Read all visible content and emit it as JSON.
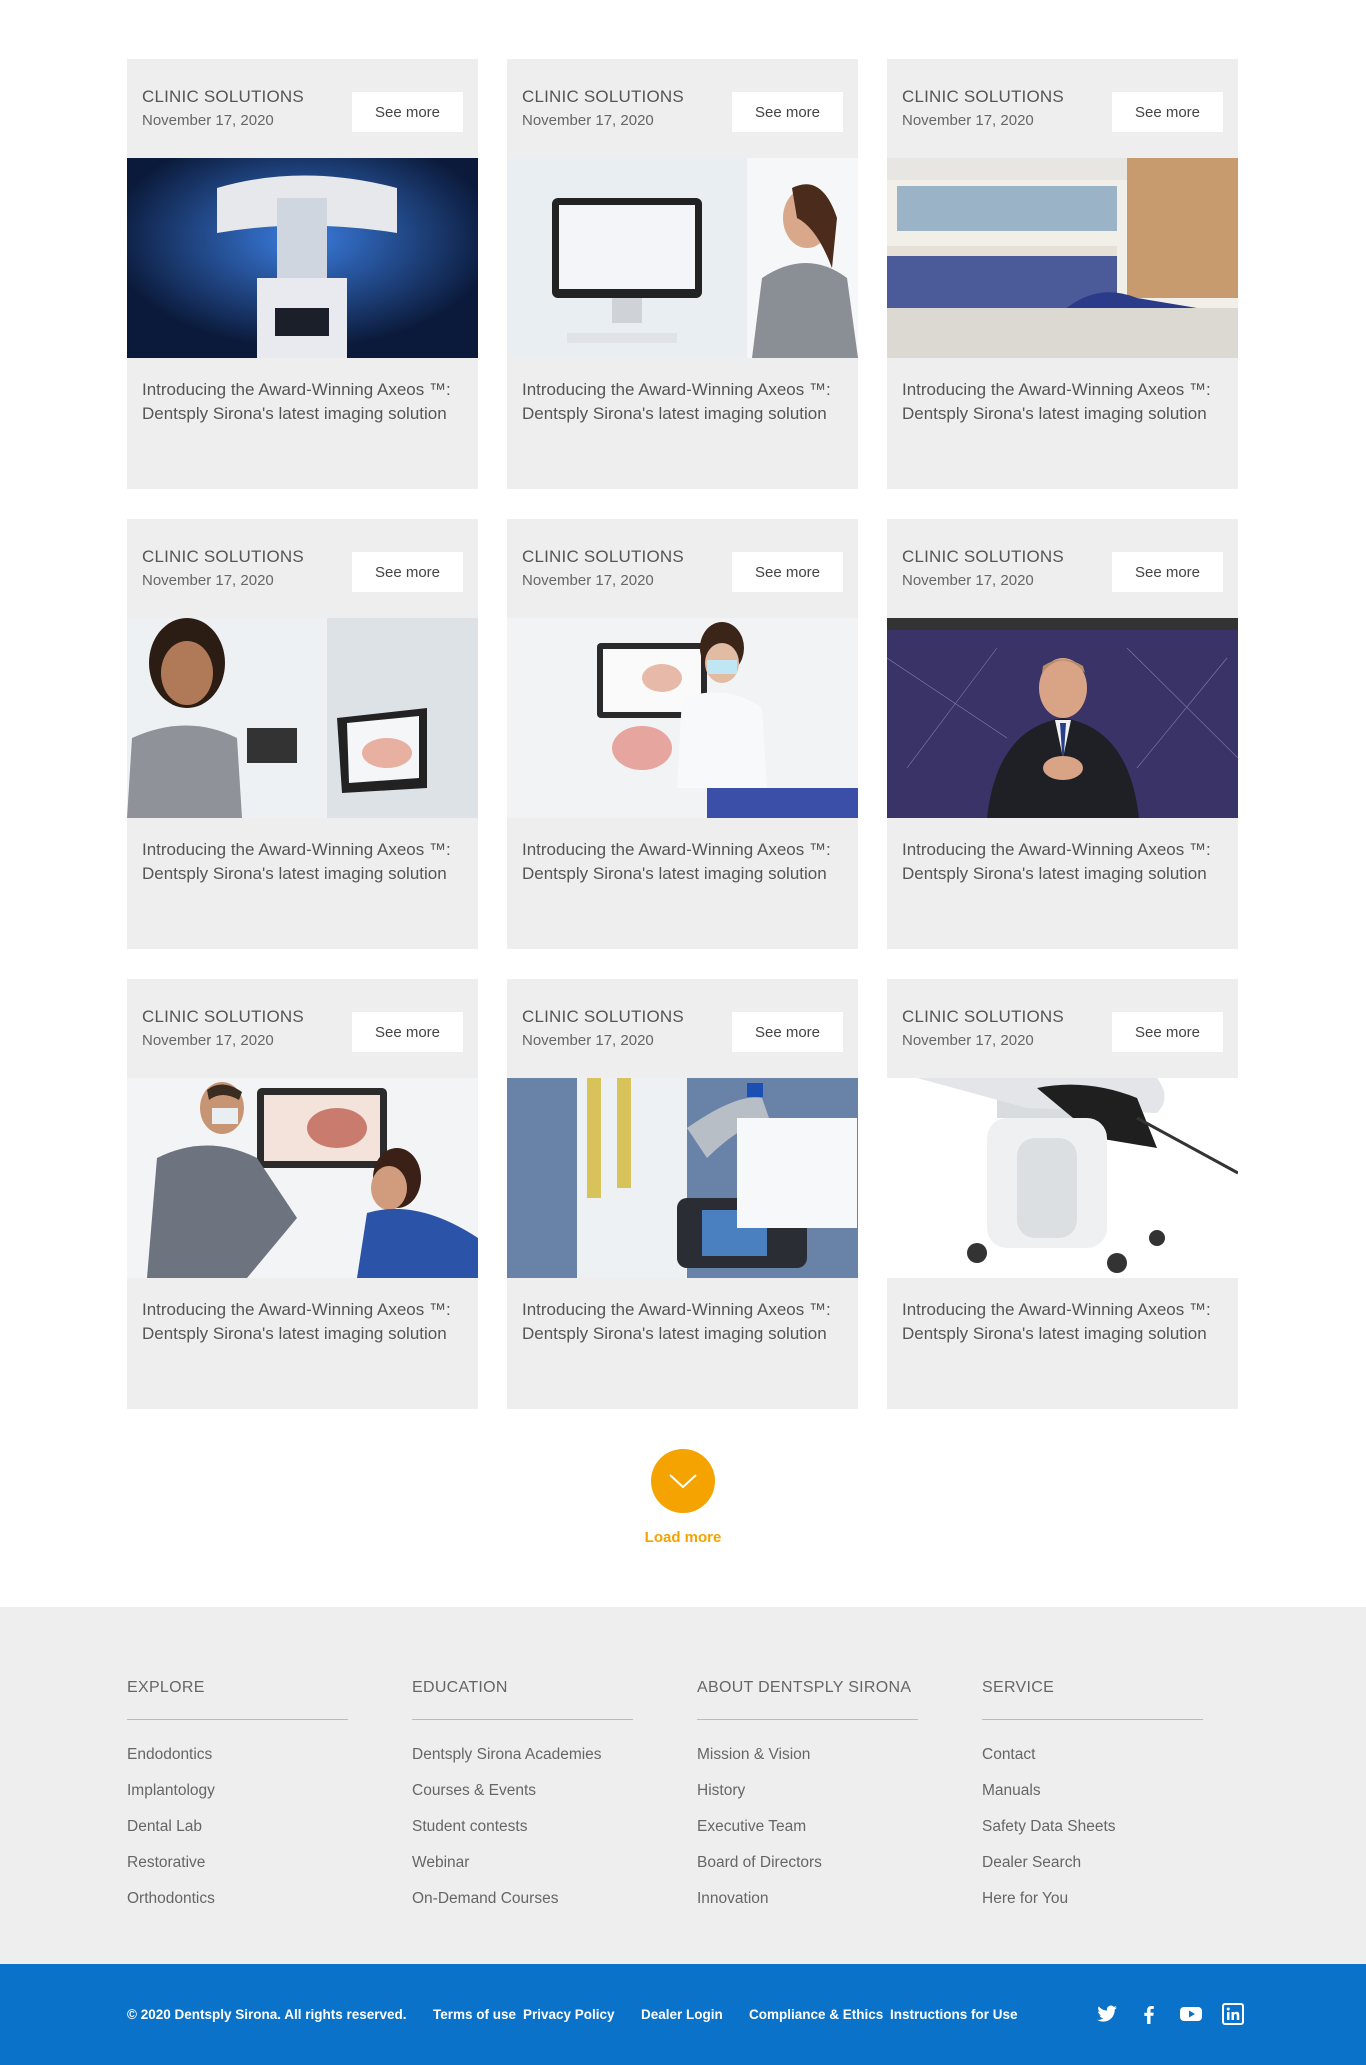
{
  "cards": [
    {
      "category": "CLINIC SOLUTIONS",
      "date": "November 17, 2020",
      "button": "See more",
      "title": "Introducing the Award-Winning Axeos ™: Dentsply Sirona's latest imaging solution",
      "image": "imaging-unit"
    },
    {
      "category": "CLINIC SOLUTIONS",
      "date": "November 17, 2020",
      "button": "See more",
      "title": "Introducing the Award-Winning Axeos ™: Dentsply Sirona's latest imaging solution",
      "image": "woman-at-computer"
    },
    {
      "category": "CLINIC SOLUTIONS",
      "date": "November 17, 2020",
      "button": "See more",
      "title": "Introducing the Award-Winning Axeos ™: Dentsply Sirona's latest imaging solution",
      "image": "dental-office"
    },
    {
      "category": "CLINIC SOLUTIONS",
      "date": "November 17, 2020",
      "button": "See more",
      "title": "Introducing the Award-Winning Axeos ™: Dentsply Sirona's latest imaging solution",
      "image": "woman-with-scanner-screen"
    },
    {
      "category": "CLINIC SOLUTIONS",
      "date": "November 17, 2020",
      "button": "See more",
      "title": "Introducing the Award-Winning Axeos ™: Dentsply Sirona's latest imaging solution",
      "image": "dental-technician"
    },
    {
      "category": "CLINIC SOLUTIONS",
      "date": "November 17, 2020",
      "button": "See more",
      "title": "Introducing the Award-Winning Axeos ™: Dentsply Sirona's latest imaging solution",
      "image": "presenter-in-suit"
    },
    {
      "category": "CLINIC SOLUTIONS",
      "date": "November 17, 2020",
      "button": "See more",
      "title": "Introducing the Award-Winning Axeos ™: Dentsply Sirona's latest imaging solution",
      "image": "dentist-with-patient"
    },
    {
      "category": "CLINIC SOLUTIONS",
      "date": "November 17, 2020",
      "button": "See more",
      "title": "Introducing the Award-Winning Axeos ™: Dentsply Sirona's latest imaging solution",
      "image": "treatment-unit-touchscreen"
    },
    {
      "category": "CLINIC SOLUTIONS",
      "date": "November 17, 2020",
      "button": "See more",
      "title": "Introducing the Award-Winning Axeos ™: Dentsply Sirona's latest imaging solution",
      "image": "intraoral-scanner-cart"
    }
  ],
  "load_more": {
    "label": "Load more",
    "icon": "chevron-down-icon",
    "color": "#f4a300"
  },
  "footer": {
    "columns": [
      {
        "heading": "EXPLORE",
        "items": [
          "Endodontics",
          "Implantology",
          "Dental Lab",
          "Restorative",
          "Orthodontics"
        ]
      },
      {
        "heading": "EDUCATION",
        "items": [
          "Dentsply Sirona Academies",
          "Courses & Events",
          "Student contests",
          "Webinar",
          "On-Demand Courses"
        ]
      },
      {
        "heading": "ABOUT DENTSPLY SIRONA",
        "items": [
          "Mission & Vision",
          "History",
          "Executive Team",
          "Board of Directors",
          "Innovation"
        ]
      },
      {
        "heading": "SERVICE",
        "items": [
          "Contact",
          "Manuals",
          "Safety Data Sheets",
          "Dealer Search",
          "Here for You"
        ]
      }
    ],
    "bottom": {
      "copyright": "© 2020 Dentsply Sirona. All rights reserved.",
      "terms": "Terms of use",
      "privacy": "Privacy Policy",
      "dealer_login": "Dealer Login",
      "compliance": "Compliance & Ethics",
      "instructions": "Instructions for Use",
      "social": [
        "twitter-icon",
        "facebook-icon",
        "youtube-icon",
        "linkedin-icon"
      ],
      "color": "#0a72c8"
    }
  }
}
